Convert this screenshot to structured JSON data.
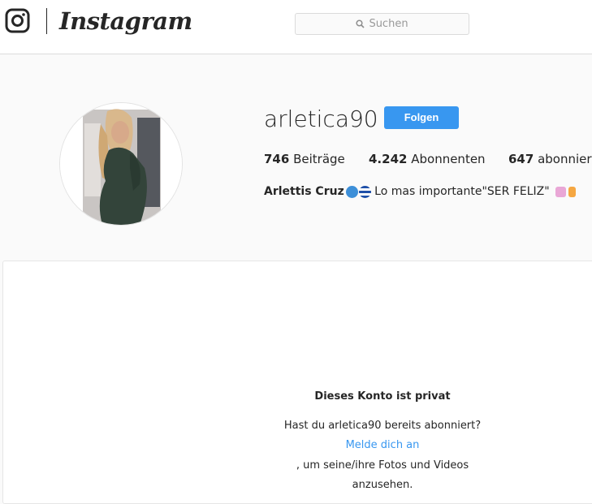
{
  "header": {
    "logo_text": "Instagram",
    "search_placeholder": "Suchen"
  },
  "profile": {
    "username": "arletica90",
    "follow_label": "Folgen",
    "stats": [
      {
        "count": "746",
        "label": "Beiträge"
      },
      {
        "count": "4.242",
        "label": "Abonnenten"
      },
      {
        "count": "647",
        "label": "abonniert"
      }
    ],
    "bio_name": "Arlettis Cruz",
    "bio_text": " Lo mas importante\"SER FELIZ\" "
  },
  "private": {
    "title": "Dieses Konto ist privat",
    "line1": "Hast du arletica90 bereits abonniert?",
    "login_link": "Melde dich an",
    "line2": ", um seine/ihre Fotos und Videos",
    "line3": "anzusehen."
  },
  "colors": {
    "accent": "#3897f0",
    "background": "#fafafa",
    "border": "#dbdbdb",
    "text": "#262626"
  }
}
